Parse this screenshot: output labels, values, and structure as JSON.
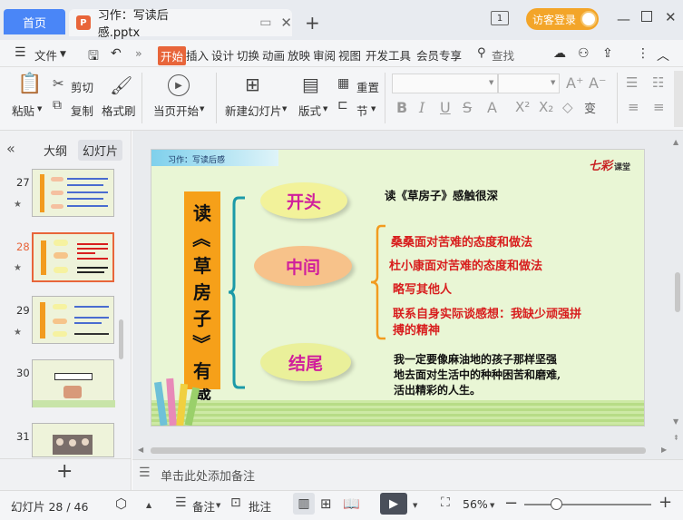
{
  "titlebar": {
    "home_tab": "首页",
    "doc_tab": "习作：写读后感.pptx",
    "add_tab": "+",
    "page_badge": "1",
    "visitor_login": "访客登录"
  },
  "menubar": {
    "file": "文件",
    "items": [
      "开始",
      "插入",
      "设计",
      "切换",
      "动画",
      "放映",
      "审阅",
      "视图",
      "开发工具",
      "会员专享"
    ],
    "search": "查找"
  },
  "ribbon": {
    "paste": "粘贴",
    "cut": "剪切",
    "copy": "复制",
    "format_painter": "格式刷",
    "start_from_current": "当页开始",
    "new_slide": "新建幻灯片",
    "layout": "版式",
    "reset": "重置",
    "section": "节",
    "font_name": "",
    "font_size": ""
  },
  "sidebar": {
    "collapse": "«",
    "tab_outline": "大纲",
    "tab_slides": "幻灯片",
    "slides": [
      {
        "num": "27"
      },
      {
        "num": "28"
      },
      {
        "num": "29"
      },
      {
        "num": "30"
      },
      {
        "num": "31"
      }
    ],
    "add": "+"
  },
  "slide": {
    "header": "习作：写读后感",
    "logo_main": "七彩",
    "logo_sub": "课堂",
    "title_col": [
      "读",
      "《",
      "草",
      "房",
      "子",
      "》",
      "有",
      "感"
    ],
    "cloud_start": "开头",
    "cloud_middle": "中间",
    "cloud_end": "结尾",
    "intro_text": "读《草房子》感触很深",
    "middle_points": [
      "桑桑面对苦难的态度和做法",
      "杜小康面对苦难的态度和做法",
      "略写其他人",
      "联系自身实际谈感想：我缺少顽强拼",
      "搏的精神"
    ],
    "ending_lines": [
      "我一定要像麻油地的孩子那样坚强",
      "地去面对生活中的种种困苦和磨难,",
      "活出精彩的人生。"
    ]
  },
  "notes": {
    "placeholder": "单击此处添加备注"
  },
  "statusbar": {
    "slide_counter": "幻灯片 28 / 46",
    "notes": "备注",
    "comments": "批注",
    "zoom": "56%"
  }
}
